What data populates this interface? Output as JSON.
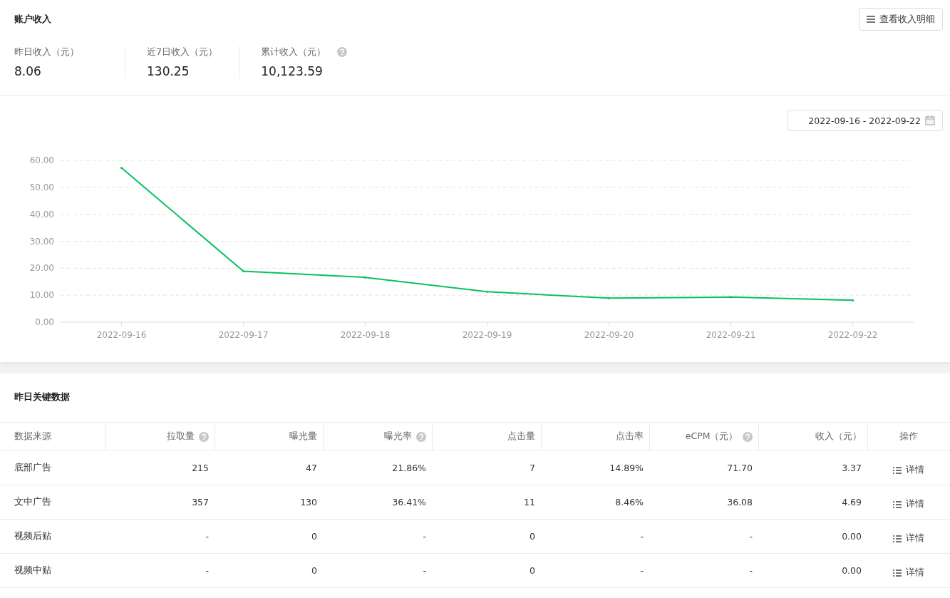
{
  "account_income": {
    "title": "账户收入",
    "detail_button": "查看收入明细",
    "stats": [
      {
        "label": "昨日收入（元）",
        "value": "8.06",
        "help": false
      },
      {
        "label": "近7日收入（元）",
        "value": "130.25",
        "help": false
      },
      {
        "label": "累计收入（元）",
        "value": "10,123.59",
        "help": true
      }
    ]
  },
  "trend": {
    "date_range": "2022-09-16 - 2022-09-22",
    "chart_data": {
      "type": "line",
      "categories": [
        "2022-09-16",
        "2022-09-17",
        "2022-09-18",
        "2022-09-19",
        "2022-09-20",
        "2022-09-21",
        "2022-09-22"
      ],
      "series": [
        {
          "color": "#07c160",
          "values": [
            57.2,
            18.9,
            16.6,
            11.3,
            8.9,
            9.3,
            8.1
          ]
        }
      ],
      "grid": true,
      "ylim": [
        0,
        60
      ],
      "yticks": [
        {
          "value": 0,
          "label": "0.00"
        },
        {
          "value": 10,
          "label": "10.00"
        },
        {
          "value": 20,
          "label": "20.00"
        },
        {
          "value": 30,
          "label": "30.00"
        },
        {
          "value": 40,
          "label": "40.00"
        },
        {
          "value": 50,
          "label": "50.00"
        },
        {
          "value": 60,
          "label": "60.00"
        }
      ]
    }
  },
  "key_data": {
    "title": "昨日关键数据",
    "table": {
      "columns": [
        {
          "label": "数据来源",
          "help": false
        },
        {
          "label": "拉取量",
          "help": true
        },
        {
          "label": "曝光量",
          "help": false
        },
        {
          "label": "曝光率",
          "help": true
        },
        {
          "label": "点击量",
          "help": false
        },
        {
          "label": "点击率",
          "help": false
        },
        {
          "label": "eCPM（元）",
          "help": true
        },
        {
          "label": "收入（元）",
          "help": false
        },
        {
          "label": "操作",
          "help": false
        }
      ],
      "rows": [
        {
          "cells": [
            "底部广告",
            "215",
            "47",
            "21.86%",
            "7",
            "14.89%",
            "71.70",
            "3.37"
          ],
          "action": "详情"
        },
        {
          "cells": [
            "文中广告",
            "357",
            "130",
            "36.41%",
            "11",
            "8.46%",
            "36.08",
            "4.69"
          ],
          "action": "详情"
        },
        {
          "cells": [
            "视频后贴",
            "-",
            "0",
            "-",
            "0",
            "-",
            "-",
            "0.00"
          ],
          "action": "详情"
        },
        {
          "cells": [
            "视频中贴",
            "-",
            "0",
            "-",
            "0",
            "-",
            "-",
            "0.00"
          ],
          "action": "详情"
        }
      ]
    }
  }
}
